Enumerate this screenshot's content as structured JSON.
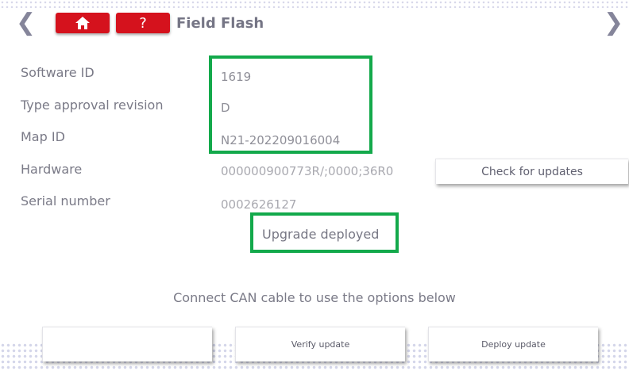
{
  "header": {
    "title": "Field Flash",
    "back_icon": "chevron-left-icon",
    "forward_icon": "chevron-right-icon",
    "home_icon": "home-icon",
    "help_label": "?",
    "accent_color": "#d5121d"
  },
  "info": {
    "software_id_label": "Software ID",
    "software_id_value": "1619",
    "type_approval_label": "Type approval revision",
    "type_approval_value": "D",
    "map_id_label": "Map ID",
    "map_id_value": "N21-202209016004",
    "hardware_label": "Hardware",
    "hardware_value": "000000900773R/;0000;36R0",
    "serial_label": "Serial number",
    "serial_value": "0002626127"
  },
  "check_updates_label": "Check for updates",
  "status_text": "Upgrade deployed",
  "hint_text": "Connect CAN cable to use the options below",
  "bottom_buttons": {
    "first_label": "",
    "verify_label": "Verify update",
    "deploy_label": "Deploy update"
  },
  "highlight_color": "#13a94b"
}
